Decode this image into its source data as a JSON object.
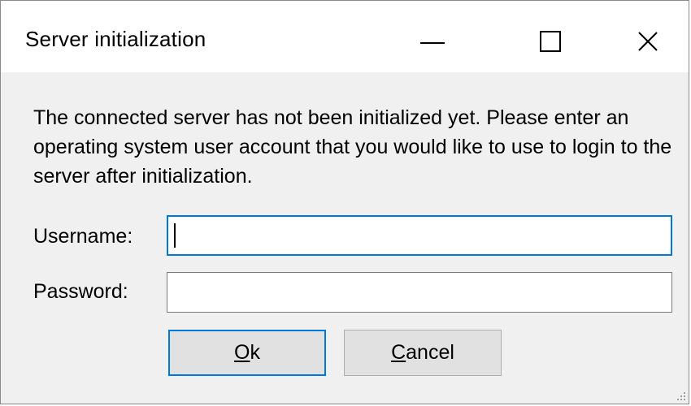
{
  "window": {
    "title": "Server initialization",
    "controls": {
      "minimize": "minimize-icon",
      "maximize": "maximize-icon",
      "close": "close-icon"
    }
  },
  "message": "The connected server has not been initialized yet. Please enter an operating system user account that you would like to use to login to the server after initialization.",
  "form": {
    "username_label": "Username:",
    "username_value": "",
    "password_label": "Password:",
    "password_value": ""
  },
  "buttons": {
    "ok": {
      "accel": "O",
      "rest": "k"
    },
    "cancel": {
      "accel": "C",
      "rest": "ancel"
    }
  },
  "colors": {
    "focus_accent": "#0078d7",
    "dialog_bg": "#f0f0f0",
    "button_bg": "#e1e1e1"
  }
}
